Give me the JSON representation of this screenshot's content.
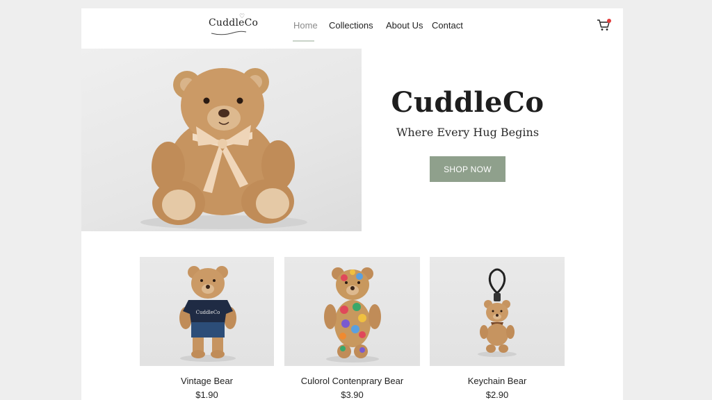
{
  "brand": {
    "logo_text": "CuddleCo"
  },
  "nav": {
    "items": [
      {
        "label": "Home",
        "active": true
      },
      {
        "label": "Collections"
      },
      {
        "label": "About Us"
      },
      {
        "label": "Contact"
      }
    ]
  },
  "cart": {
    "icon": "shopping-cart-icon",
    "badge_color": "#e23b3b"
  },
  "hero": {
    "title": "CuddleCo",
    "subtitle": "Where Every Hug Begins",
    "cta_label": "SHOP NOW",
    "cta_color": "#8fa08c",
    "image": "teddy-bear-with-ribbon"
  },
  "products": [
    {
      "name": "Vintage Bear",
      "price": "$1.90",
      "image": "bear-in-navy-shirt"
    },
    {
      "name": "Culorol Contenprary Bear",
      "price": "$3.90",
      "image": "multicolor-patchwork-bear"
    },
    {
      "name": "Keychain Bear",
      "price": "$2.90",
      "image": "keychain-bear"
    }
  ],
  "colors": {
    "accent": "#8fa08c",
    "background": "#eeeeee",
    "card": "#ffffff"
  }
}
